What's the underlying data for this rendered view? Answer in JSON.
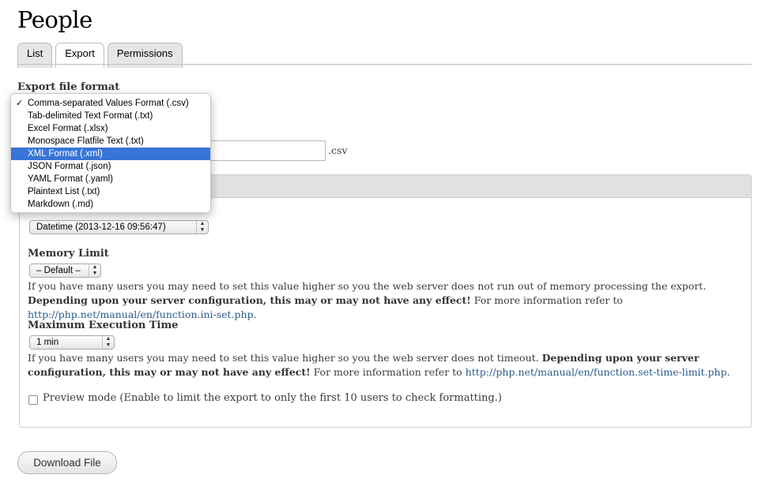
{
  "page": {
    "title": "People"
  },
  "tabs": [
    {
      "label": "List",
      "active": false
    },
    {
      "label": "Export",
      "active": true
    },
    {
      "label": "Permissions",
      "active": false
    }
  ],
  "export_format": {
    "label": "Export file format",
    "options": [
      {
        "label": "Comma-separated Values Format (.csv)",
        "checked": true
      },
      {
        "label": "Tab-delimited Text Format (.txt)"
      },
      {
        "label": "Excel Format (.xlsx)"
      },
      {
        "label": "Monospace Flatfile Text (.txt)"
      },
      {
        "label": "XML Format (.xml)",
        "highlighted": true
      },
      {
        "label": "JSON Format (.json)"
      },
      {
        "label": "YAML Format (.yaml)"
      },
      {
        "label": "Plaintext List (.txt)"
      },
      {
        "label": "Markdown (.md)"
      }
    ],
    "check_glyph": "✓"
  },
  "filename": {
    "value": "",
    "suffix": ".csv"
  },
  "date_format": {
    "value": "Datetime (2013-12-16 09:56:47)"
  },
  "memory_limit": {
    "label": "Memory Limit",
    "value": "– Default –",
    "help_plain": "If you have many users you may need to set this value higher so you the web server does not run out of memory processing the export. ",
    "help_bold": "Depending upon your server configuration, this may or may not have any effect!",
    "help_tail": " For more information refer to ",
    "link": "http://php.net/manual/en/function.ini-set.php",
    "end": "."
  },
  "max_execution": {
    "label": "Maximum Execution Time",
    "value": "1 min",
    "help_plain": "If you have many users you may need to set this value higher so you the web server does not timeout. ",
    "help_bold": "Depending upon your server configuration, this may or may not have any effect!",
    "help_tail": " For more information refer to ",
    "link": "http://php.net/manual/en/function.set-time-limit.php",
    "end": "."
  },
  "preview": {
    "label": "Preview mode (Enable to limit the export to only the first 10 users to check formatting.)",
    "checked": false
  },
  "download": {
    "label": "Download File"
  },
  "colors": {
    "highlight": "#3875d7",
    "link": "#2a5b8a"
  }
}
